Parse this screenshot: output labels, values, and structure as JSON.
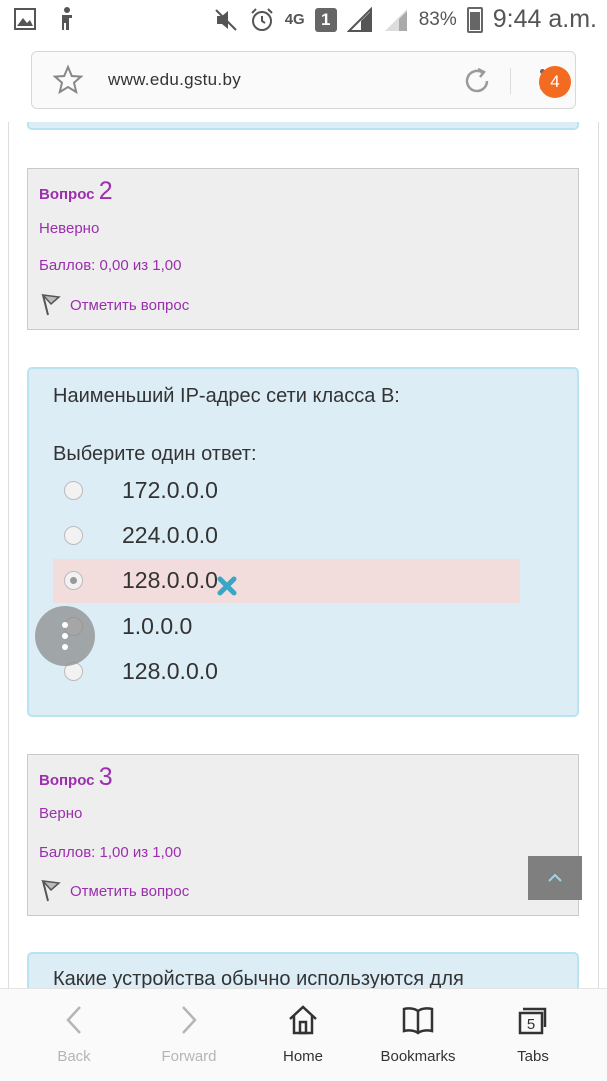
{
  "status_bar": {
    "network": "4G",
    "sim": "1",
    "battery": "83%",
    "time": "9:44 a.m."
  },
  "browser": {
    "url": "www.edu.gstu.by",
    "tab_count_badge": "4"
  },
  "question2": {
    "label": "Вопрос",
    "number": "2",
    "state": "Неверно",
    "grade": "Баллов: 0,00 из 1,00",
    "flag_label": "Отметить вопрос"
  },
  "question2_body": {
    "text": "Наименьший IP-адрес сети класса B:",
    "prompt": "Выберите один ответ:",
    "options": [
      {
        "label": "172.0.0.0"
      },
      {
        "label": "224.0.0.0"
      },
      {
        "label": "128.0.0.0"
      },
      {
        "label": "1.0.0.0"
      },
      {
        "label": "128.0.0.0"
      }
    ],
    "selected_index": 2
  },
  "question3": {
    "label": "Вопрос",
    "number": "3",
    "state": "Верно",
    "grade": "Баллов: 1,00 из 1,00",
    "flag_label": "Отметить вопрос"
  },
  "question3_body": {
    "text_partial": "Какие устройства обычно используются для"
  },
  "bottom_nav": {
    "back": "Back",
    "forward": "Forward",
    "home": "Home",
    "bookmarks": "Bookmarks",
    "tabs": "Tabs",
    "tabs_count": "5"
  },
  "colors": {
    "accent_purple": "#9b2fae",
    "question_bg": "#dcedf6",
    "question_border": "#b9e2f2",
    "wrong_answer_bg": "#f3dcdc",
    "incorrect_mark": "#3aa6c6",
    "badge_orange": "#f36b21"
  }
}
